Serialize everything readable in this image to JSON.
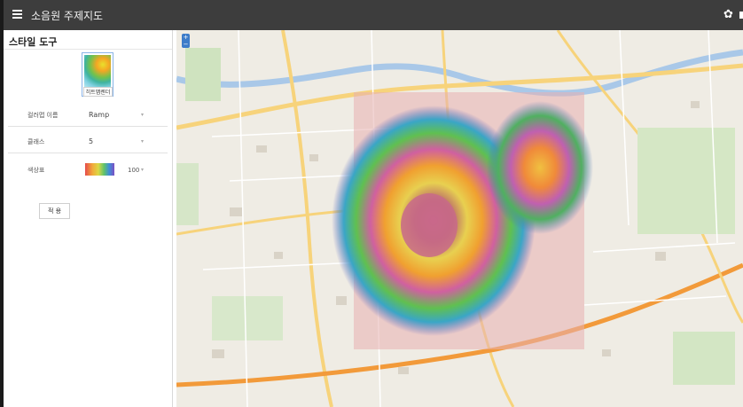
{
  "header": {
    "title": "소음원 주제지도"
  },
  "panel": {
    "title": "스타일 도구",
    "thumbnail_label": "히트맵렌더",
    "rows": [
      {
        "label": "컬러맵 이름",
        "value": "Ramp"
      },
      {
        "label": "클래스",
        "value": "5"
      },
      {
        "label": "색상표",
        "value": "100"
      }
    ],
    "apply_label": "적 용"
  },
  "colors": {
    "header_bg": "#3d3d3d",
    "accent": "#3d7cc9"
  },
  "icons": [
    "hamburger-menu-icon",
    "gear-icon",
    "zoom-control-icon"
  ]
}
